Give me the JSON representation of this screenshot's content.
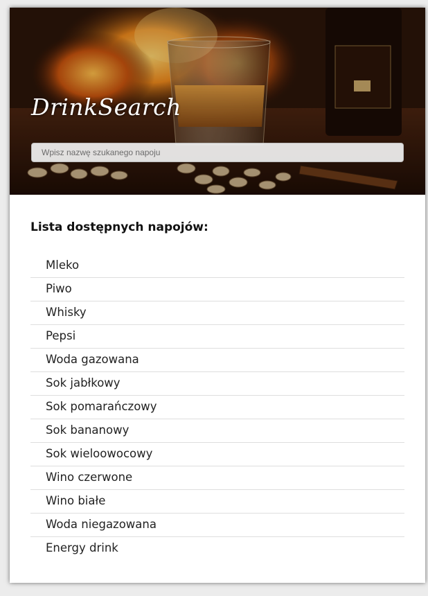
{
  "header": {
    "logo": "DrinkSearch",
    "background_image": "whisky-glass-fireplace-image",
    "search": {
      "placeholder": "Wpisz nazwę szukanego napoju",
      "value": ""
    }
  },
  "main": {
    "heading": "Lista dostępnych napojów:",
    "drinks": [
      "Mleko",
      "Piwo",
      "Whisky",
      "Pepsi",
      "Woda gazowana",
      "Sok jabłkowy",
      "Sok pomarańczowy",
      "Sok bananowy",
      "Sok wieloowocowy",
      "Wino czerwone",
      "Wino białe",
      "Woda niegazowana",
      "Energy drink"
    ]
  },
  "colors": {
    "page_background": "#ececec",
    "card_background": "#ffffff",
    "text": "#222222",
    "divider": "#dedede"
  }
}
